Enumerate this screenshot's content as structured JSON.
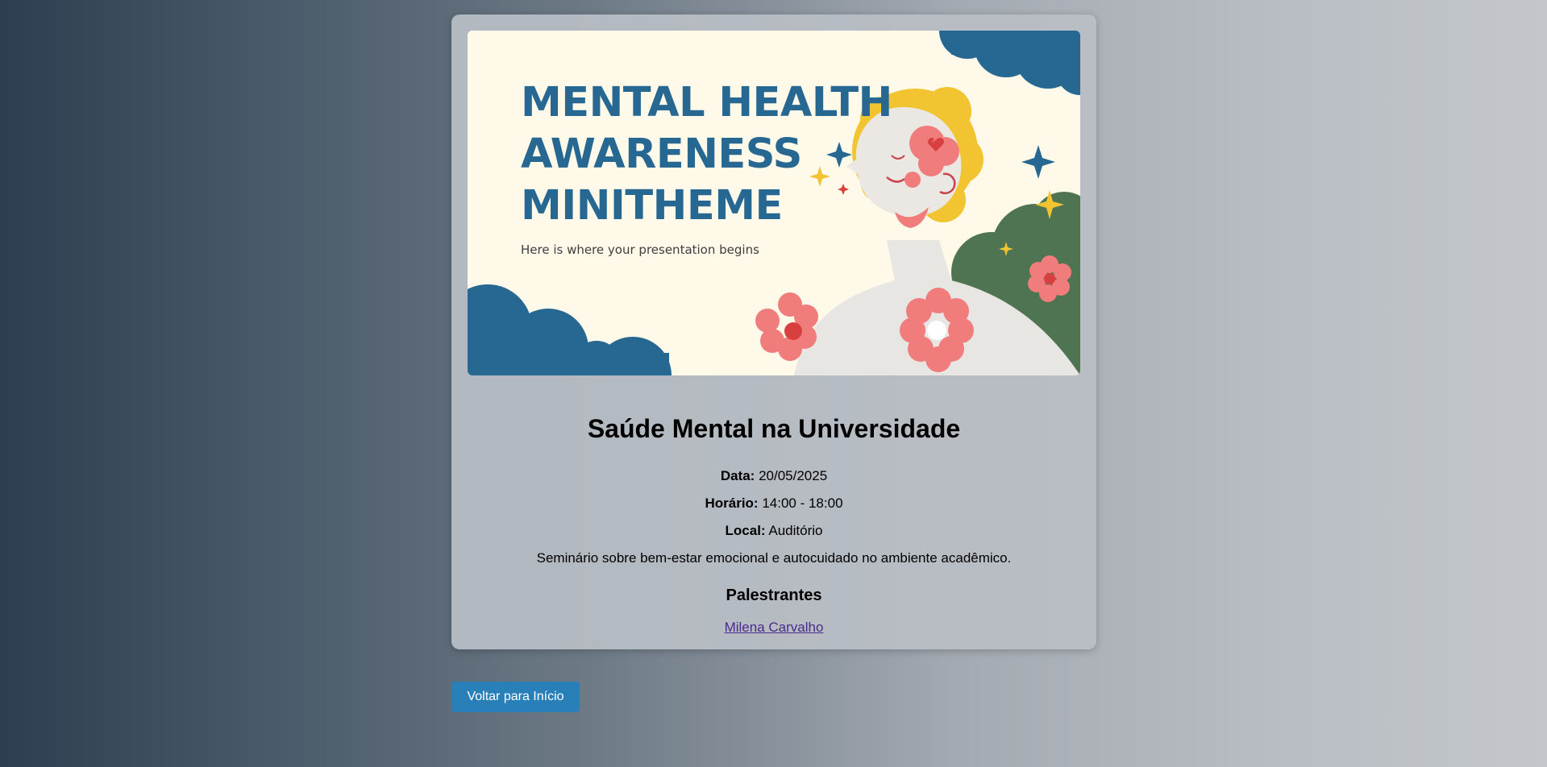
{
  "banner": {
    "title_lines": [
      "MENTAL HEALTH",
      "AWARENESS",
      "MINITHEME"
    ],
    "subtitle": "Here is where your presentation begins"
  },
  "event": {
    "title": "Saúde Mental na Universidade",
    "date_label": "Data:",
    "date_value": "20/05/2025",
    "time_label": "Horário:",
    "time_value": "14:00 - 18:00",
    "place_label": "Local:",
    "place_value": "Auditório",
    "description": "Seminário sobre bem-estar emocional e autocuidado no ambiente acadêmico.",
    "speakers_heading": "Palestrantes",
    "speakers": [
      "Milena Carvalho"
    ]
  },
  "back_button": "Voltar para Início",
  "colors": {
    "button": "#2980b9",
    "banner_title": "#276893",
    "banner_background": "#fef9e8",
    "link": "#4a2a8f"
  }
}
